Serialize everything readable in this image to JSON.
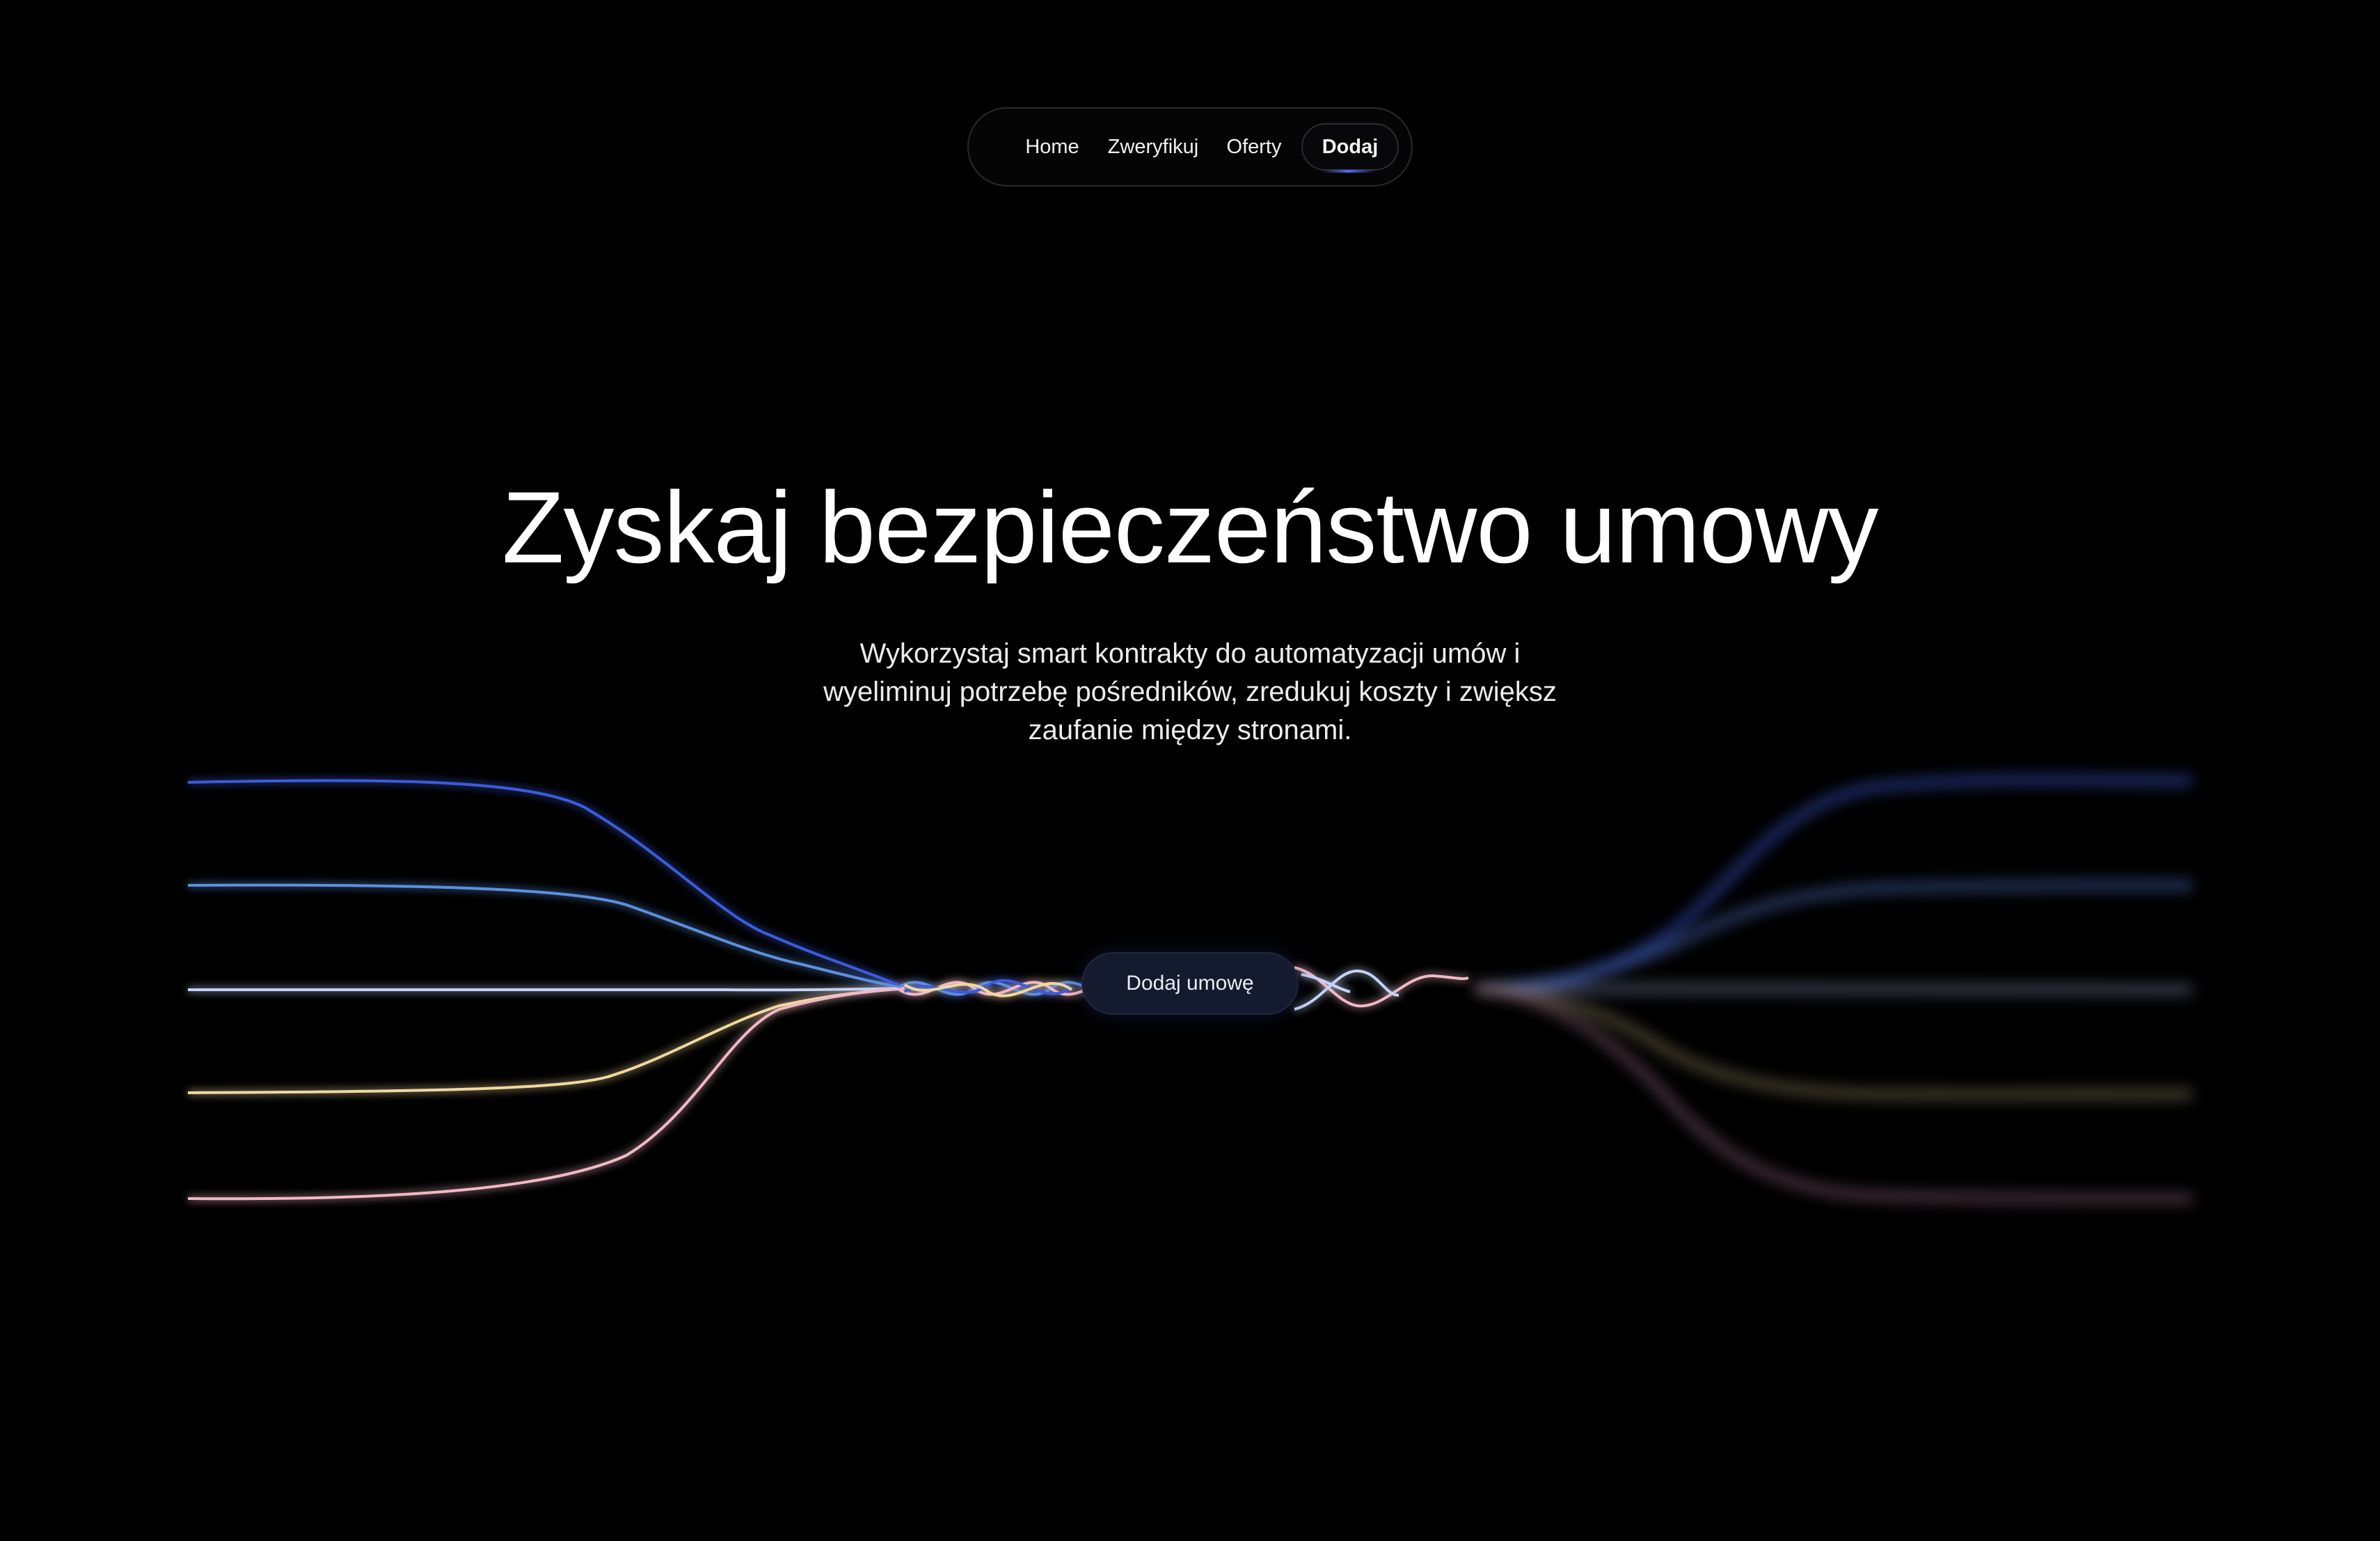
{
  "nav": {
    "items": [
      {
        "label": "Home"
      },
      {
        "label": "Zweryfikuj"
      },
      {
        "label": "Oferty"
      },
      {
        "label": "Dodaj",
        "active": true
      }
    ]
  },
  "hero": {
    "title": "Zyskaj bezpieczeństwo umowy",
    "subtitle": "Wykorzystaj smart kontrakty do automatyzacji umów i wyeliminuj potrzebę pośredników, zredukuj koszty i zwiększ zaufanie między stronami.",
    "cta_label": "Dodaj umowę"
  },
  "colors": {
    "background": "#000000",
    "wave_blue": "#3b5bdb",
    "wave_light_blue": "#5b8fe0",
    "wave_pale_blue": "#c3d4f5",
    "wave_yellow": "#f0d9a0",
    "wave_pink": "#f2b8c6"
  }
}
